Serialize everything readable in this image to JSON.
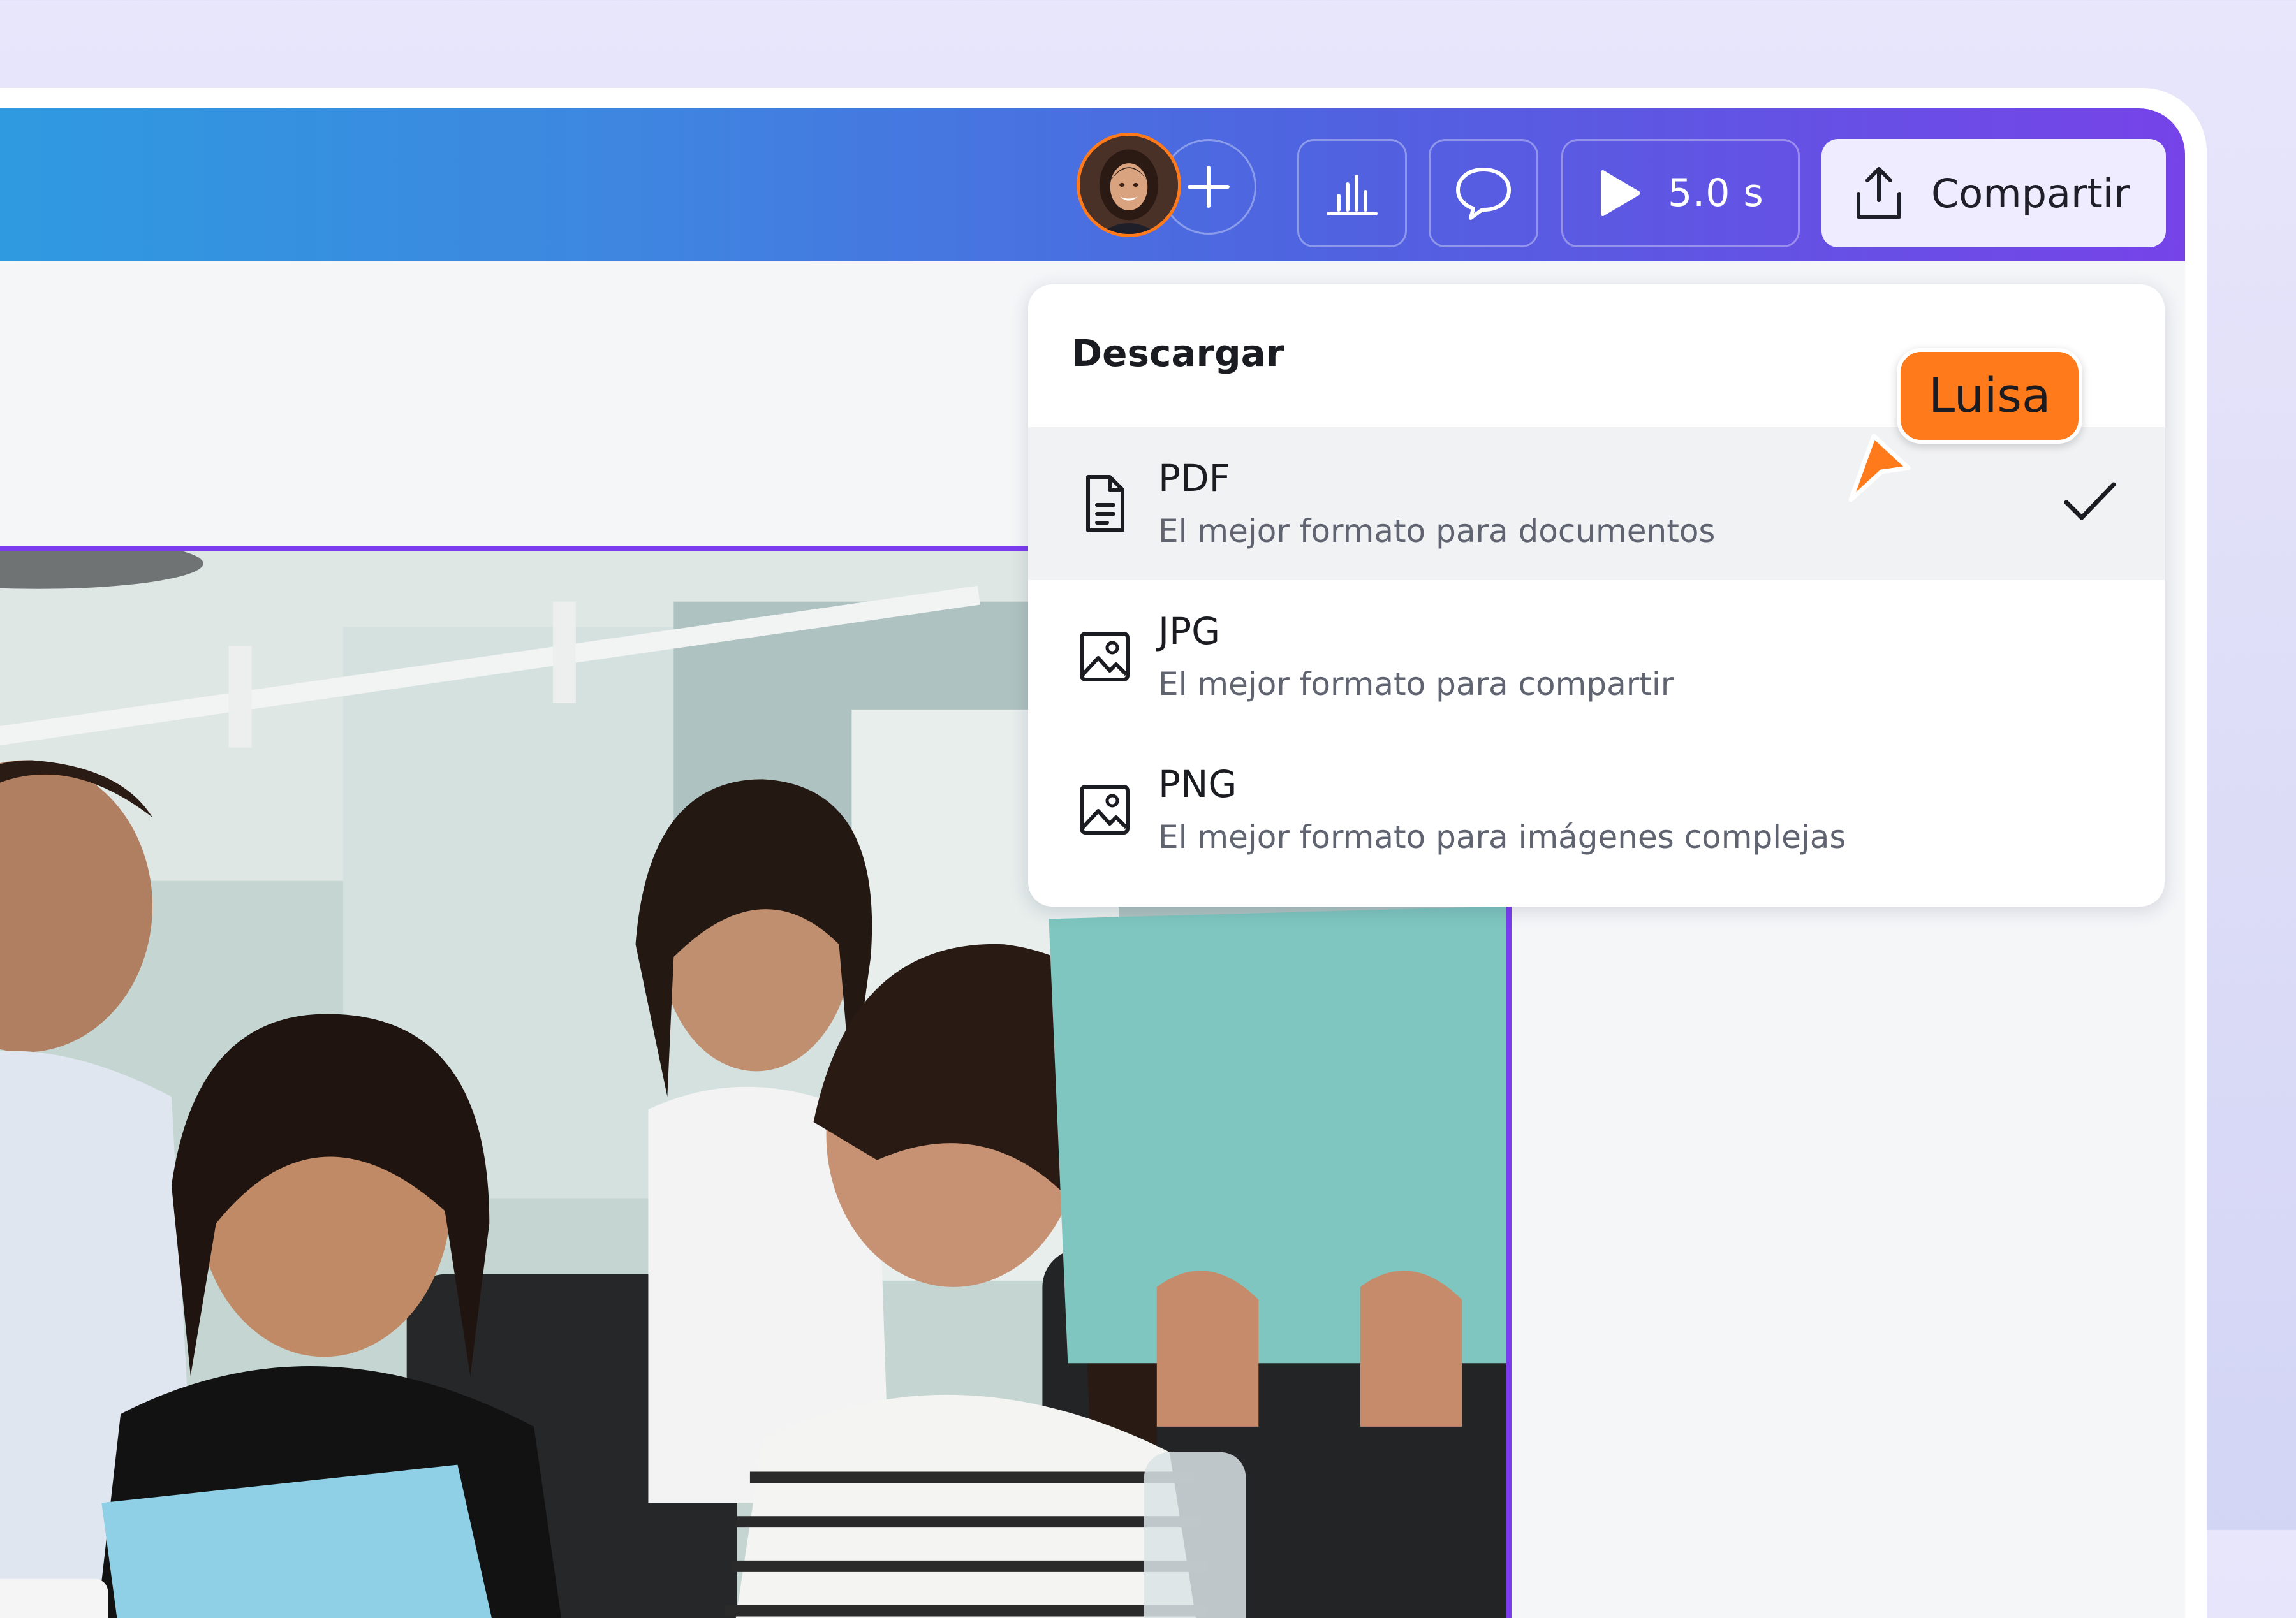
{
  "topbar": {
    "collaborator_avatar": "user-avatar-photo",
    "add_collaborator_icon": "plus-icon",
    "insights_icon": "bar-chart-icon",
    "comment_icon": "speech-bubble-icon",
    "present": {
      "icon": "play-icon",
      "duration": "5.0 s"
    },
    "share": {
      "icon": "upload-icon",
      "label": "Compartir"
    }
  },
  "download_menu": {
    "title": "Descargar",
    "options": [
      {
        "name": "PDF",
        "description": "El mejor formato para documentos",
        "icon": "document-icon",
        "selected": true
      },
      {
        "name": "JPG",
        "description": "El mejor formato para compartir",
        "icon": "image-icon",
        "selected": false
      },
      {
        "name": "PNG",
        "description": "El mejor formato para imágenes complejas",
        "icon": "image-icon",
        "selected": false
      }
    ]
  },
  "collaborator_cursor": {
    "name": "Luisa",
    "color": "#ff7a1a"
  },
  "theme": {
    "accent": "#7b3cf0",
    "topbar_gradient": [
      "#2e9be0",
      "#5062e0",
      "#7643e8"
    ],
    "share_button_bg": "#f0ecff"
  },
  "canvas": {
    "content": "photo"
  }
}
